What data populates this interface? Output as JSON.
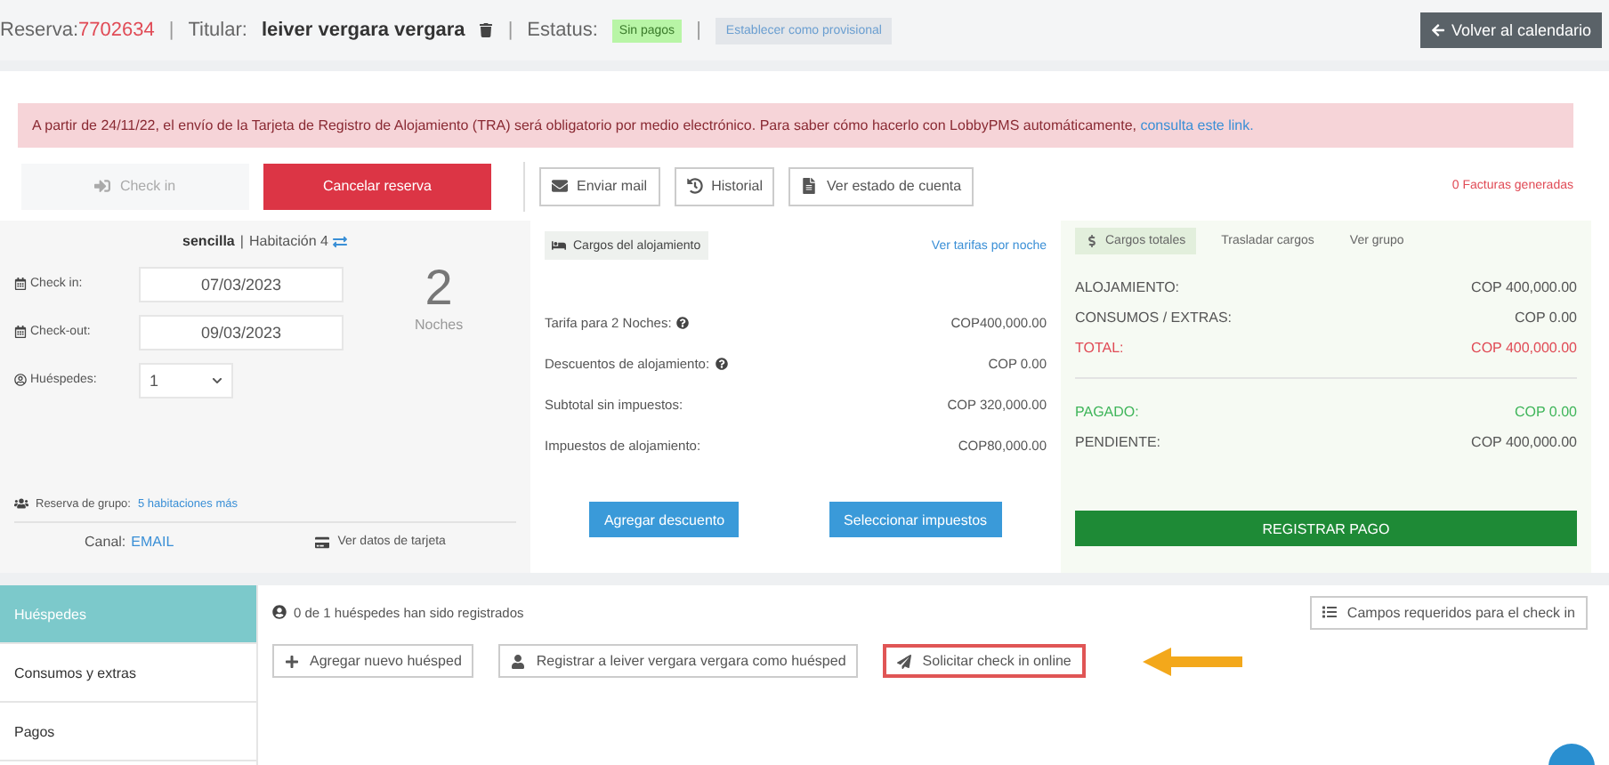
{
  "header": {
    "separators": [
      "|",
      "|",
      "|"
    ],
    "reservation_label": "Reserva:",
    "reservation_number": "7702634",
    "holder_label": "Titular:",
    "holder_name": "leiver vergara vergara",
    "status_label": "Estatus:",
    "status_badge": "Sin pagos",
    "provisional_button": "Establecer como provisional",
    "back_button": "Volver al calendario"
  },
  "alert": {
    "text": "A partir de 24/11/22, el envío de la Tarjeta de Registro de Alojamiento (TRA) será obligatorio por medio electrónico. Para saber cómo hacerlo con LobbyPMS automáticamente,",
    "link": "consulta este link."
  },
  "actions": [
    {
      "label": "Check in",
      "kind": "ghost",
      "disabled": true
    },
    {
      "label": "Cancelar reserva",
      "kind": "danger",
      "disabled": false
    },
    {
      "label": "Enviar mail",
      "kind": "outline",
      "disabled": false
    },
    {
      "label": "Historial",
      "kind": "outline",
      "disabled": false
    },
    {
      "label": "Ver estado de cuenta",
      "kind": "outline",
      "disabled": false
    }
  ],
  "invoices": "0 Facturas generadas",
  "stay": {
    "room_type": "sencilla",
    "room_separator": "|",
    "room": "Habitación 4",
    "fields": [
      {
        "label": "Check in:",
        "value": "07/03/2023",
        "kind": "date"
      },
      {
        "label": "Check-out:",
        "value": "09/03/2023",
        "kind": "date"
      },
      {
        "label": "Huéspedes:",
        "value": "1",
        "kind": "select"
      }
    ],
    "nights_count": "2",
    "nights_label": "Noches",
    "group_label": "Reserva de grupo:",
    "group_link": "5 habitaciones más",
    "channel_label": "Canal:",
    "channel_value": "EMAIL",
    "card_link": "Ver datos de tarjeta"
  },
  "lodging": {
    "title": "Cargos del alojamiento",
    "rates_link": "Ver tarifas por noche",
    "rows": [
      {
        "label": "Tarifa para 2 Noches:",
        "value": "COP400,000.00",
        "help": true
      },
      {
        "label": "Descuentos de alojamiento:",
        "value": "COP 0.00",
        "help": true
      },
      {
        "label": "Subtotal sin impuestos:",
        "value": "COP 320,000.00",
        "help": false
      },
      {
        "label": "Impuestos de alojamiento:",
        "value": "COP80,000.00",
        "help": false
      }
    ],
    "buttons": [
      "Agregar descuento",
      "Seleccionar impuestos"
    ]
  },
  "totals": {
    "tabs": [
      {
        "label": "Cargos totales",
        "selected": true
      },
      {
        "label": "Trasladar cargos",
        "selected": false
      },
      {
        "label": "Ver grupo",
        "selected": false
      }
    ],
    "summary": [
      {
        "label": "ALOJAMIENTO:",
        "value": "COP 400,000.00",
        "color": "#555555"
      },
      {
        "label": "CONSUMOS / EXTRAS:",
        "value": "COP 0.00",
        "color": "#555555"
      },
      {
        "label": "TOTAL:",
        "value": "COP 400,000.00",
        "color": "#e04a55"
      }
    ],
    "balance": [
      {
        "label": "PAGADO:",
        "value": "COP 0.00",
        "color": "#3fb55a"
      },
      {
        "label": "PENDIENTE:",
        "value": "COP 400,000.00",
        "color": "#555555"
      }
    ],
    "pay_button": "REGISTRAR PAGO"
  },
  "guests": {
    "tabs": [
      {
        "label": "Huéspedes",
        "selected": true
      },
      {
        "label": "Consumos y extras",
        "selected": false
      },
      {
        "label": "Pagos",
        "selected": false
      }
    ],
    "registered_text": "0 de 1 huéspedes han sido registrados",
    "required_button": "Campos requeridos para el check in",
    "buttons": [
      {
        "label": "Agregar nuevo huésped",
        "highlighted": false
      },
      {
        "label": "Registrar a leiver vergara vergara como huésped",
        "highlighted": false
      },
      {
        "label": "Solicitar check in online",
        "highlighted": true
      }
    ]
  }
}
